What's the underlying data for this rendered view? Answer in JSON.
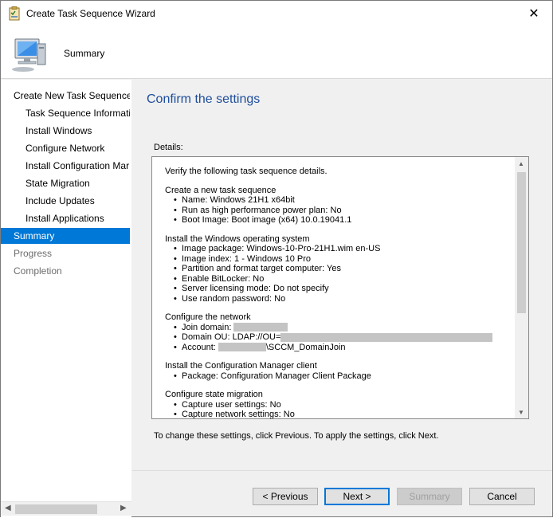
{
  "window": {
    "title": "Create Task Sequence Wizard",
    "close_glyph": "✕"
  },
  "header": {
    "title": "Summary"
  },
  "nav": {
    "items": [
      {
        "label": "Create New Task Sequence",
        "level": 0,
        "state": "normal"
      },
      {
        "label": "Task Sequence Informati",
        "level": 1,
        "state": "normal"
      },
      {
        "label": "Install Windows",
        "level": 1,
        "state": "normal"
      },
      {
        "label": "Configure Network",
        "level": 1,
        "state": "normal"
      },
      {
        "label": "Install Configuration Mar",
        "level": 1,
        "state": "normal"
      },
      {
        "label": "State Migration",
        "level": 1,
        "state": "normal"
      },
      {
        "label": "Include Updates",
        "level": 1,
        "state": "normal"
      },
      {
        "label": "Install Applications",
        "level": 1,
        "state": "normal"
      },
      {
        "label": "Summary",
        "level": 0,
        "state": "selected"
      },
      {
        "label": "Progress",
        "level": 0,
        "state": "disabled"
      },
      {
        "label": "Completion",
        "level": 0,
        "state": "disabled"
      }
    ]
  },
  "main": {
    "heading": "Confirm the settings",
    "details_label": "Details:",
    "intro": "Verify the following task sequence details.",
    "sections": [
      {
        "title": "Create a new task sequence",
        "lines": [
          "Name: Windows 21H1 x64bit",
          "Run as high performance power plan: No",
          "Boot Image: Boot image (x64) 10.0.19041.1"
        ]
      },
      {
        "title": "Install the Windows operating system",
        "lines": [
          "Image package: Windows-10-Pro-21H1.wim  en-US",
          "Image index: 1 - Windows 10 Pro",
          "Partition and format target computer: Yes",
          "Enable BitLocker: No",
          "Server licensing mode: Do not specify",
          "Use random password: No"
        ]
      },
      {
        "title": "Configure the network",
        "lines": []
      },
      {
        "title": "Install the Configuration Manager client",
        "lines": [
          "Package: Configuration Manager Client Package"
        ]
      },
      {
        "title": "Configure state migration",
        "lines": [
          "Capture user settings: No"
        ]
      }
    ],
    "network": {
      "join_domain": "Join domain:",
      "domain_ou": "Domain OU: LDAP://OU=",
      "account": "Account:",
      "account_suffix": "\\SCCM_DomainJoin"
    },
    "cut_line": "Capture network settings: No",
    "change_text": "To change these settings, click Previous. To apply the settings, click Next."
  },
  "buttons": {
    "previous": "< Previous",
    "next": "Next >",
    "summary": "Summary",
    "cancel": "Cancel"
  },
  "colors": {
    "accent": "#0078d7",
    "heading": "#1e4e9c"
  }
}
